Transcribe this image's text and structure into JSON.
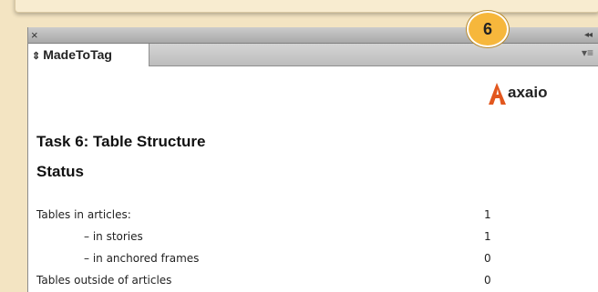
{
  "panel": {
    "close_glyph": "×",
    "collapse_glyph": "◂◂",
    "tab_arrows": "⇕",
    "tab_label": "MadeToTag",
    "menu_glyph": "▾≡"
  },
  "badge": {
    "number": "6"
  },
  "logo": {
    "text": "axaio",
    "mark_color": "#e2571e"
  },
  "task": {
    "title": "Task 6: Table Structure",
    "status_heading": "Status"
  },
  "status_rows": [
    {
      "label": "Tables in articles:",
      "value": "1"
    },
    {
      "label": "– in stories",
      "value": "1"
    },
    {
      "label": "– in anchored frames",
      "value": "0"
    },
    {
      "label": "Tables outside of articles",
      "value": "0"
    }
  ]
}
